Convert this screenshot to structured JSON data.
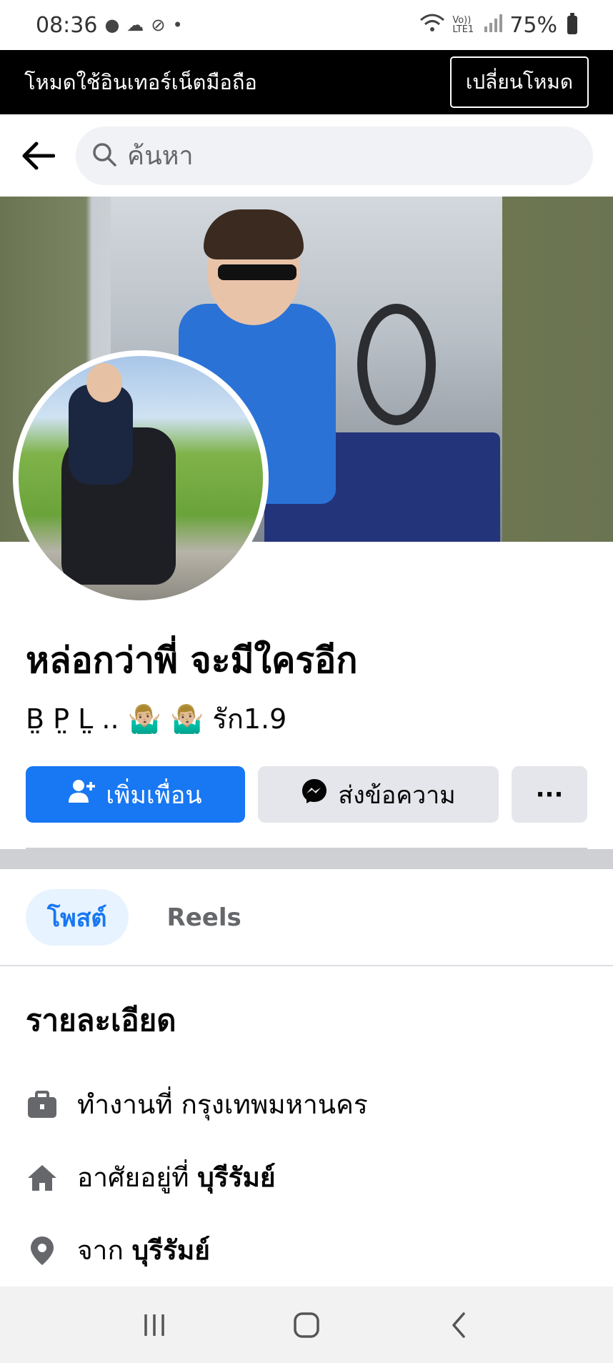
{
  "status_bar": {
    "time": "08:36",
    "left_icons": [
      "line-icon",
      "cloud-icon",
      "data-saver-icon",
      "dot-icon"
    ],
    "right_icons": [
      "wifi-icon",
      "volte-icon",
      "signal-icon",
      "battery-icon"
    ],
    "volte_label": "Vo)) LTE1",
    "battery": "75%"
  },
  "banner": {
    "text": "โหมดใช้อินเทอร์เน็ตมือถือ",
    "switch_label": "เปลี่ยนโหมด"
  },
  "search": {
    "placeholder": "ค้นหา"
  },
  "profile": {
    "name": "หล่อกว่าพี่ จะมีใครอีก",
    "bio": "B̤ P̤ L̤ ..   🤷🏼‍♂️ 🤷🏼‍♂️ รัก1.9"
  },
  "actions": {
    "add_friend": "เพิ่มเพื่อน",
    "message": "ส่งข้อความ",
    "more": "···"
  },
  "tabs": [
    {
      "label": "โพสต์",
      "active": true
    },
    {
      "label": "Reels",
      "active": false
    }
  ],
  "details": {
    "title": "รายละเอียด",
    "work_prefix": "ทำงานที่ กรุงเทพมหานคร",
    "lives_prefix": "อาศัยอยู่ที่",
    "lives_value": "บุรีรัมย์",
    "from_prefix": "จาก",
    "from_value": "บุรีรัมย์"
  },
  "colors": {
    "accent": "#1877f2",
    "button_gray": "#e4e6eb",
    "banner_bg": "#000000"
  }
}
